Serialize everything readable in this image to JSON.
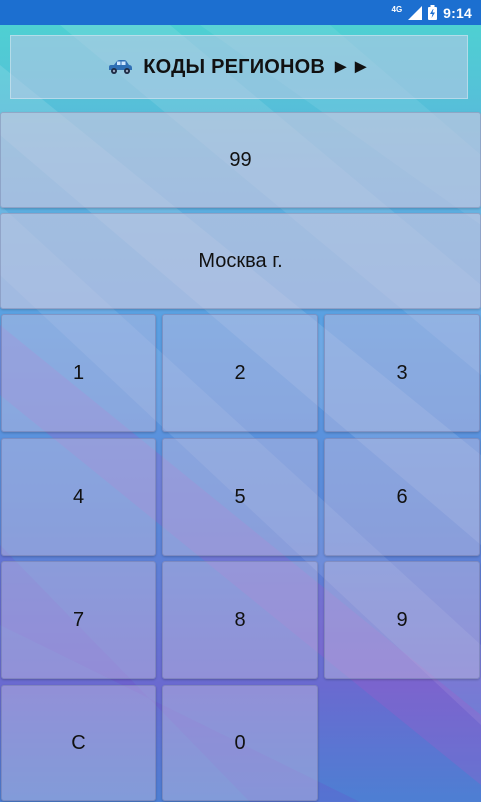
{
  "status_bar": {
    "network": "4G",
    "time": "9:14"
  },
  "header": {
    "title": "КОДЫ РЕГИОНОВ ►►",
    "icon": "car-icon"
  },
  "display": {
    "code": "99",
    "region": "Москва г."
  },
  "keypad": {
    "k1": "1",
    "k2": "2",
    "k3": "3",
    "k4": "4",
    "k5": "5",
    "k6": "6",
    "k7": "7",
    "k8": "8",
    "k9": "9",
    "clear": "C",
    "k0": "0"
  },
  "colors": {
    "status_bar": "#1c6fd0",
    "car": "#2f6fb5"
  }
}
